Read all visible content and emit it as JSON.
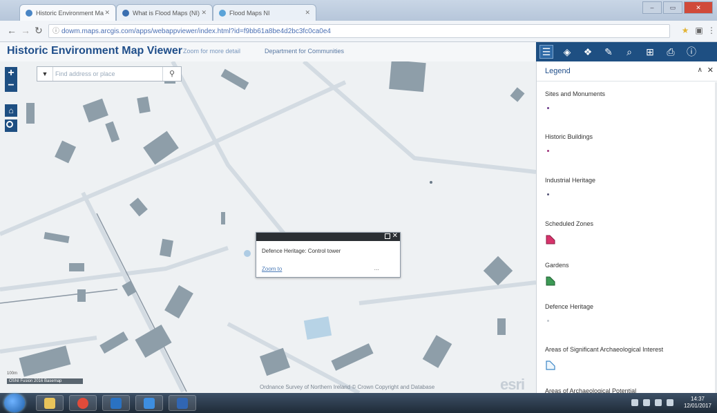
{
  "browser": {
    "tabs": [
      {
        "label": "Historic Environment Ma",
        "active": true
      },
      {
        "label": "What is Flood Maps (NI)",
        "active": false
      },
      {
        "label": "Flood Maps NI",
        "active": false
      }
    ],
    "url": "dowm.maps.arcgis.com/apps/webappviewer/index.html?id=f9bb61a8be4d2bc3fc0ca0e4",
    "window_controls": [
      "minimise",
      "maximise",
      "close"
    ]
  },
  "app": {
    "title": "Historic Environment Map Viewer",
    "sub_links": [
      "Zoom for more detail",
      "Department for Communities"
    ]
  },
  "toolbar": {
    "icons": [
      "legend-icon",
      "layers-icon",
      "basemap-icon",
      "draw-icon",
      "query-icon",
      "grid-icon",
      "print-icon",
      "about-icon"
    ],
    "active": "legend-icon",
    "color": "#1e4f82"
  },
  "map": {
    "zoom_in": "+",
    "zoom_out": "−",
    "search": {
      "placeholder": "Find address or place"
    },
    "popup": {
      "title": "Defence Heritage: Control tower",
      "zoom_link": "Zoom to",
      "more": "..."
    },
    "scale": "100m",
    "scale_label": "OSNI Fusion 2016 Basemap",
    "attribution": "Ordnance Survey of Northern Ireland © Crown Copyright and Database",
    "logo": "esri"
  },
  "legend": {
    "title": "Legend",
    "items": [
      {
        "label": "Sites and Monuments",
        "symbol": "dot",
        "color": "#6b3a8a"
      },
      {
        "label": "Historic Buildings",
        "symbol": "dot",
        "color": "#a0337a"
      },
      {
        "label": "Industrial Heritage",
        "symbol": "dot",
        "color": "#555577"
      },
      {
        "label": "Scheduled Zones",
        "symbol": "polygon",
        "color": "#d7336b"
      },
      {
        "label": "Gardens",
        "symbol": "polygon",
        "color": "#3c9a55"
      },
      {
        "label": "Defence Heritage",
        "symbol": "dot",
        "color": "#c0c6cc"
      },
      {
        "label": "Areas of Significant Archaeological Interest",
        "symbol": "polygon-outline",
        "color": "#3b86c6"
      },
      {
        "label": "Areas of Archaeological Potential",
        "symbol": "polygon",
        "color": "#a3c7e6"
      }
    ]
  },
  "taskbar": {
    "apps": [
      {
        "name": "file-explorer-icon",
        "color": "#e8c35a"
      },
      {
        "name": "chrome-icon",
        "color": "#e04b3a"
      },
      {
        "name": "outlook-icon",
        "color": "#2a72c2"
      },
      {
        "name": "dropbox-icon",
        "color": "#3d8ee0"
      },
      {
        "name": "word-icon",
        "color": "#3166b3"
      }
    ],
    "time": "14:37",
    "date": "12/01/2017"
  }
}
